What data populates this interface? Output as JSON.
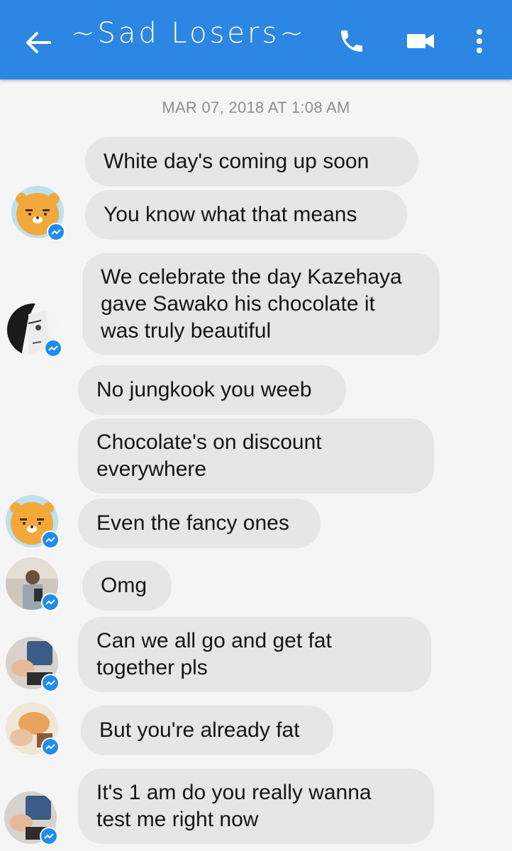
{
  "header": {
    "title": "~Sad Losers~",
    "back_icon": "arrow-left-icon",
    "call_icon": "phone-icon",
    "video_icon": "video-camera-icon",
    "more_icon": "more-vertical-icon",
    "bar_color": "#2b86e4"
  },
  "timestamp": "MAR 07, 2018 AT 1:08 AM",
  "messages": [
    {
      "lines": [
        "White day's coming up soon"
      ]
    },
    {
      "lines": [
        "You know what that means"
      ]
    },
    {
      "lines": [
        "We celebrate the day Kazehaya",
        "gave Sawako his chocolate it",
        "was truly beautiful"
      ]
    },
    {
      "lines": [
        "No jungkook you weeb"
      ]
    },
    {
      "lines": [
        "Chocolate's on discount",
        "everywhere"
      ]
    },
    {
      "lines": [
        "Even the fancy ones"
      ]
    },
    {
      "lines": [
        "Omg"
      ]
    },
    {
      "lines": [
        "Can we all go and get fat",
        "together pls"
      ]
    },
    {
      "lines": [
        "But you're already fat"
      ]
    },
    {
      "lines": [
        "It's 1 am do you really wanna",
        "test me right now"
      ]
    }
  ],
  "colors": {
    "bubble": "#e6e6e6",
    "badge": "#1e8cf0",
    "background": "#f5f5f5"
  }
}
